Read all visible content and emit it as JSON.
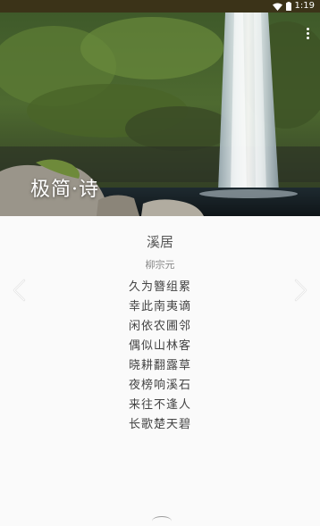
{
  "status_bar": {
    "time": "1:19",
    "background": "#3b3318"
  },
  "header": {
    "app_title": "极简·诗"
  },
  "poem": {
    "title": "溪居",
    "author": "柳宗元",
    "lines": [
      "久为簪组累",
      "幸此南夷谪",
      "闲依农圃邻",
      "偶似山林客",
      "晓耕翻露草",
      "夜榜响溪石",
      "来往不逢人",
      "长歌楚天碧"
    ]
  },
  "icons": {
    "menu": "more-vert-icon",
    "prev": "chevron-left-icon",
    "next": "chevron-right-icon",
    "wifi": "wifi-icon",
    "battery": "battery-icon"
  }
}
